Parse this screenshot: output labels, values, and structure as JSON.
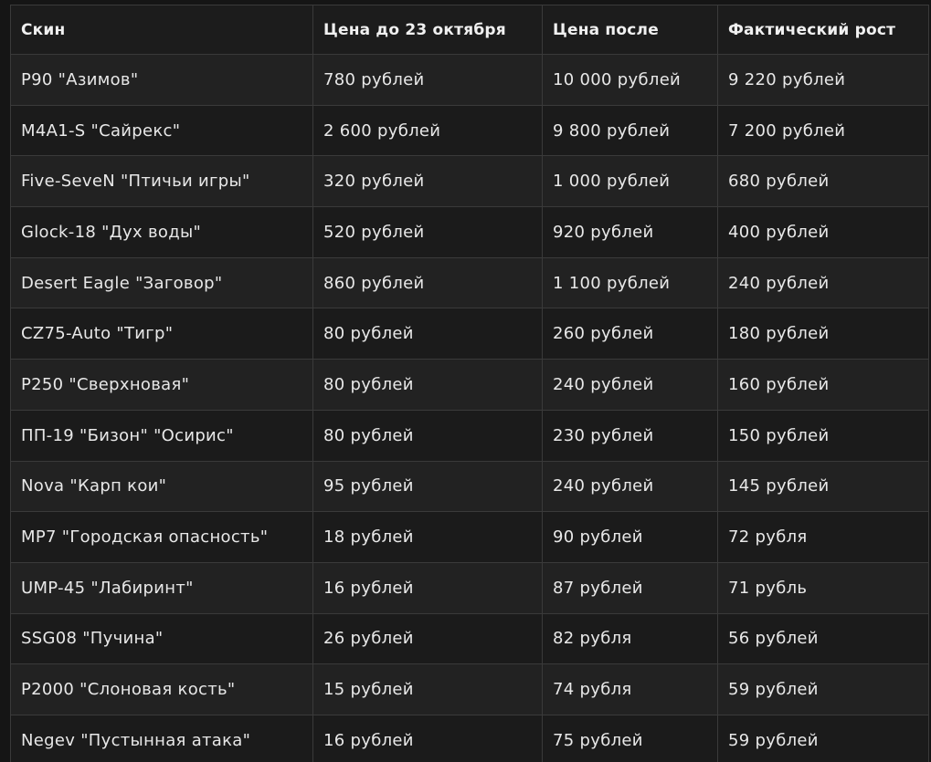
{
  "table": {
    "headers": [
      "Скин",
      "Цена до 23 октября",
      "Цена после",
      "Фактический рост"
    ],
    "rows": [
      [
        "P90 \"Азимов\"",
        "780 рублей",
        "10 000 рублей",
        "9 220 рублей"
      ],
      [
        "M4A1-S \"Сайрекс\"",
        "2 600 рублей",
        "9 800 рублей",
        "7 200 рублей"
      ],
      [
        "Five-SeveN \"Птичьи игры\"",
        "320 рублей",
        "1 000 рублей",
        "680 рублей"
      ],
      [
        "Glock-18 \"Дух воды\"",
        "520 рублей",
        "920 рублей",
        "400 рублей"
      ],
      [
        "Desert Eagle \"Заговор\"",
        "860 рублей",
        "1 100 рублей",
        "240 рублей"
      ],
      [
        "CZ75-Auto \"Тигр\"",
        "80 рублей",
        "260 рублей",
        "180 рублей"
      ],
      [
        "P250 \"Сверхновая\"",
        "80 рублей",
        "240 рублей",
        "160 рублей"
      ],
      [
        "ПП-19 \"Бизон\" \"Осирис\"",
        "80 рублей",
        "230 рублей",
        "150 рублей"
      ],
      [
        "Nova \"Карп кои\"",
        "95 рублей",
        "240 рублей",
        "145 рублей"
      ],
      [
        "MP7 \"Городская опасность\"",
        "18 рублей",
        "90 рублей",
        "72 рубля"
      ],
      [
        "UMP-45 \"Лабиринт\"",
        "16 рублей",
        "87 рублей",
        "71 рубль"
      ],
      [
        "SSG08 \"Пучина\"",
        "26 рублей",
        "82 рубля",
        "56 рублей"
      ],
      [
        "P2000 \"Слоновая кость\"",
        "15 рублей",
        "74 рубля",
        "59 рублей"
      ],
      [
        "Negev \"Пустынная атака\"",
        "16 рублей",
        "75 рублей",
        "59 рублей"
      ]
    ]
  }
}
